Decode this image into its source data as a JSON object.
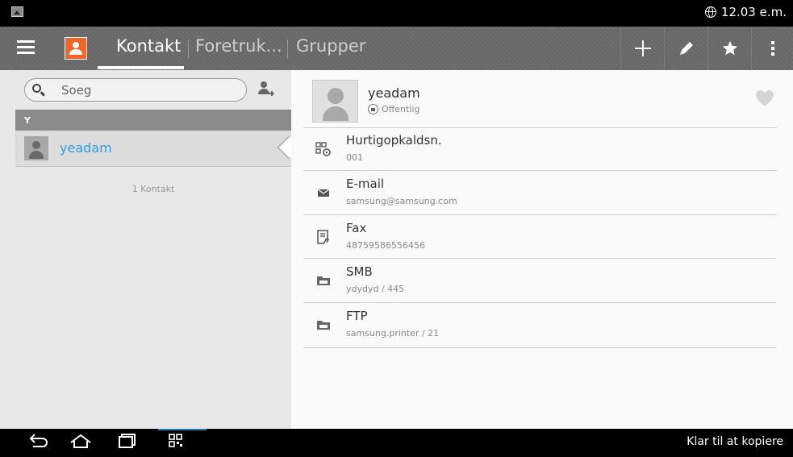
{
  "status_bar": {
    "time": "12.03 e.m.",
    "icons": [
      "photo-icon",
      "globe-icon"
    ]
  },
  "action_bar": {
    "app_icon": "contacts-app-icon",
    "tabs": [
      {
        "label": "Kontakt",
        "selected": true
      },
      {
        "label": "Foretruk...",
        "selected": false
      },
      {
        "label": "Grupper",
        "selected": false
      }
    ],
    "actions": [
      "add-icon",
      "edit-pencil-icon",
      "star-icon",
      "overflow-menu-icon"
    ]
  },
  "left_panel": {
    "search": {
      "placeholder": "Soeg",
      "value": ""
    },
    "section_letter": "Y",
    "contacts": [
      {
        "name": "yeadam"
      }
    ],
    "count_text": "1 Kontakt"
  },
  "detail": {
    "name": "yeadam",
    "privacy": "Offentlig",
    "fields": [
      {
        "icon": "speed-dial-icon",
        "label": "Hurtigopkaldsn.",
        "value": "001"
      },
      {
        "icon": "email-envelope-icon",
        "label": "E-mail",
        "value": "samsung@samsung.com"
      },
      {
        "icon": "fax-icon",
        "label": "Fax",
        "value": "48759586556456"
      },
      {
        "icon": "smb-folder-icon",
        "label": "SMB",
        "value": "ydydyd / 445"
      },
      {
        "icon": "ftp-folder-icon",
        "label": "FTP",
        "value": "samsung.printer / 21"
      }
    ],
    "favorite": false
  },
  "nav_bar": {
    "buttons": [
      "back-icon",
      "home-icon",
      "recent-apps-icon",
      "qr-scan-icon"
    ],
    "status_text": "Klar til at kopiere"
  },
  "colors": {
    "accent_blue": "#2aa0dd",
    "app_orange": "#f26522",
    "action_bar": "#6a6a6a"
  }
}
